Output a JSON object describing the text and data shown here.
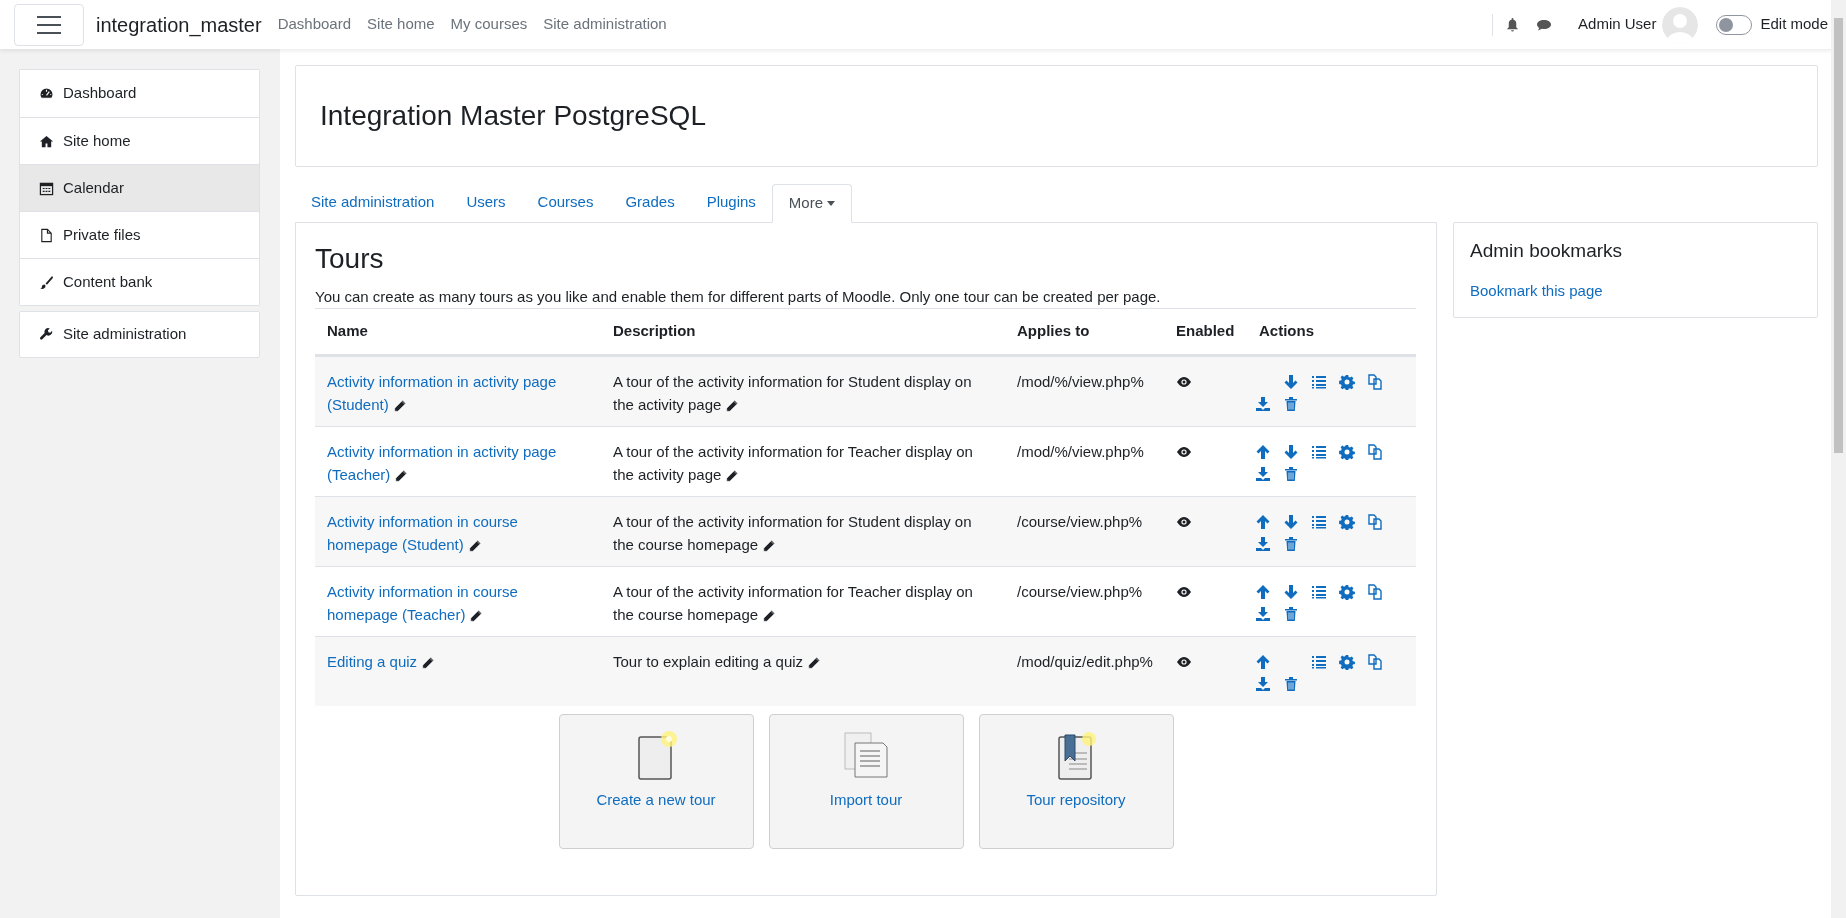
{
  "navbar": {
    "site_name": "integration_master",
    "links": [
      "Dashboard",
      "Site home",
      "My courses",
      "Site administration"
    ],
    "user_name": "Admin User",
    "edit_mode": {
      "label": "Edit mode",
      "on": false
    }
  },
  "sidebar": {
    "items": [
      {
        "label": "Dashboard",
        "selected": false
      },
      {
        "label": "Site home",
        "selected": false
      },
      {
        "label": "Calendar",
        "selected": true
      },
      {
        "label": "Private files",
        "selected": false
      },
      {
        "label": "Content bank",
        "selected": false
      }
    ],
    "admin_item": {
      "label": "Site administration"
    }
  },
  "header": {
    "title": "Integration Master PostgreSQL"
  },
  "tabs": [
    {
      "label": "Site administration",
      "selected": false
    },
    {
      "label": "Users",
      "selected": false
    },
    {
      "label": "Courses",
      "selected": false
    },
    {
      "label": "Grades",
      "selected": false
    },
    {
      "label": "Plugins",
      "selected": false
    },
    {
      "label": "More",
      "selected": true,
      "dropdown": true
    }
  ],
  "page": {
    "title": "Tours",
    "intro": "You can create as many tours as you like and enable them for different parts of Moodle. Only one tour can be created per page."
  },
  "table": {
    "columns": [
      "Name",
      "Description",
      "Applies to",
      "Enabled",
      "Actions"
    ],
    "rows": [
      {
        "name": "Activity information in activity page (Student)",
        "description": "A tour of the activity information for Student display on the activity page",
        "applies_to": "/mod/%/view.php%",
        "enabled": true,
        "can_move_up": false,
        "can_move_down": true
      },
      {
        "name": "Activity information in activity page (Teacher)",
        "description": "A tour of the activity information for Teacher display on the activity page",
        "applies_to": "/mod/%/view.php%",
        "enabled": true,
        "can_move_up": true,
        "can_move_down": true
      },
      {
        "name": "Activity information in course homepage (Student)",
        "description": "A tour of the activity information for Student display on the course homepage",
        "applies_to": "/course/view.php%",
        "enabled": true,
        "can_move_up": true,
        "can_move_down": true
      },
      {
        "name": "Activity information in course homepage (Teacher)",
        "description": "A tour of the activity information for Teacher display on the course homepage",
        "applies_to": "/course/view.php%",
        "enabled": true,
        "can_move_up": true,
        "can_move_down": true
      },
      {
        "name": "Editing a quiz",
        "description": "Tour to explain editing a quiz",
        "applies_to": "/mod/quiz/edit.php%",
        "enabled": true,
        "can_move_up": true,
        "can_move_down": false
      }
    ]
  },
  "tiles": [
    {
      "label": "Create a new tour",
      "kind": "new"
    },
    {
      "label": "Import tour",
      "kind": "import"
    },
    {
      "label": "Tour repository",
      "kind": "repository"
    }
  ],
  "bookmarks": {
    "title": "Admin bookmarks",
    "link": "Bookmark this page"
  }
}
